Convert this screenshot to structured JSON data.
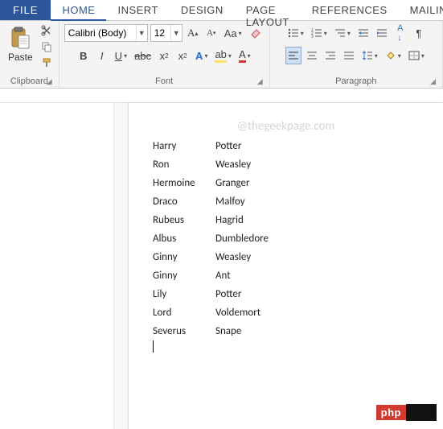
{
  "tabs": {
    "file": "FILE",
    "home": "HOME",
    "insert": "INSERT",
    "design": "DESIGN",
    "page_layout": "PAGE LAYOUT",
    "references": "REFERENCES",
    "mailings": "MAILINGS"
  },
  "clipboard": {
    "paste": "Paste",
    "label": "Clipboard"
  },
  "font": {
    "name": "Calibri (Body)",
    "size": "12",
    "label": "Font"
  },
  "paragraph": {
    "label": "Paragraph"
  },
  "watermark": "@thegeekpage.com",
  "doc_lines": [
    {
      "c1": "Harry",
      "c2": "Potter"
    },
    {
      "c1": "Ron",
      "c2": "Weasley"
    },
    {
      "c1": "Hermoine",
      "c2": "Granger"
    },
    {
      "c1": "Draco",
      "c2": "Malfoy"
    },
    {
      "c1": "Rubeus",
      "c2": "Hagrid"
    },
    {
      "c1": "Albus",
      "c2": "Dumbledore"
    },
    {
      "c1": "Ginny",
      "c2": "Weasley"
    },
    {
      "c1": "Ginny",
      "c2": "Ant"
    },
    {
      "c1": "Lily",
      "c2": "Potter"
    },
    {
      "c1": "Lord",
      "c2": "Voldemort"
    },
    {
      "c1": "Severus",
      "c2": "Snape"
    }
  ],
  "badge": {
    "left": "php"
  },
  "colors": {
    "accent": "#2b579a"
  }
}
